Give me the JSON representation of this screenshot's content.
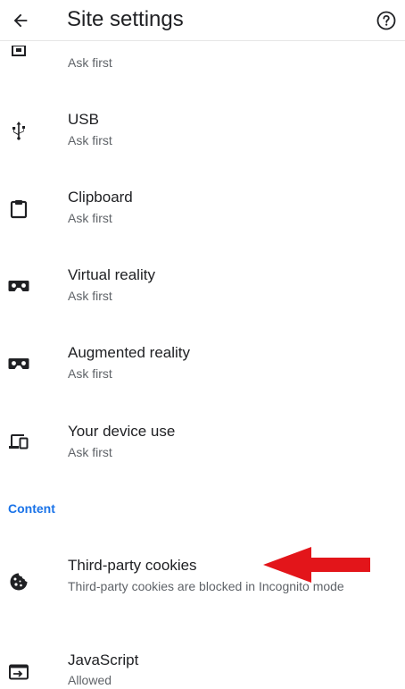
{
  "header": {
    "title": "Site settings",
    "back_icon": "arrow-back-icon",
    "help_icon": "help-circle-icon"
  },
  "items": [
    {
      "label": "",
      "sub": "Ask first",
      "icon": "partial-icon"
    },
    {
      "label": "USB",
      "sub": "Ask first",
      "icon": "usb-icon"
    },
    {
      "label": "Clipboard",
      "sub": "Ask first",
      "icon": "clipboard-icon"
    },
    {
      "label": "Virtual reality",
      "sub": "Ask first",
      "icon": "vr-headset-icon"
    },
    {
      "label": "Augmented reality",
      "sub": "Ask first",
      "icon": "ar-headset-icon"
    },
    {
      "label": "Your device use",
      "sub": "Ask first",
      "icon": "devices-icon"
    }
  ],
  "section": {
    "content_label": "Content"
  },
  "content_items": [
    {
      "label": "Third-party cookies",
      "sub": "Third-party cookies are blocked in Incognito mode",
      "icon": "cookie-icon"
    },
    {
      "label": "JavaScript",
      "sub": "Allowed",
      "icon": "javascript-icon"
    }
  ],
  "colors": {
    "accent": "#1a73e8",
    "arrow": "#e3151a",
    "text_primary": "#202124",
    "text_secondary": "#5f6368"
  }
}
